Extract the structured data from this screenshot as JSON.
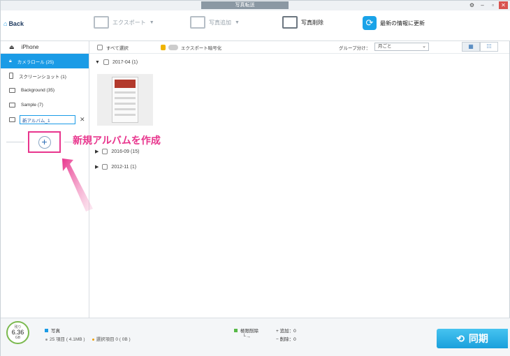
{
  "window": {
    "title": "写真転送"
  },
  "toolbar": {
    "back_label": "Back",
    "export_label": "エクスポート",
    "add_photo_label": "写真追加",
    "delete_photo_label": "写真削除",
    "refresh_label": "最新の情報に更新"
  },
  "sidebar": {
    "device": "iPhone",
    "items": [
      {
        "label": "カメラロール (25)"
      },
      {
        "label": "スクリーンショット (1)"
      },
      {
        "label": "Background (35)"
      },
      {
        "label": "Sample (7)"
      }
    ],
    "new_album_value": "新アルバム_1"
  },
  "filterbar": {
    "select_all": "すべて選択",
    "encrypt_export": "エクスポート暗号化",
    "group_label": "グループ分け：",
    "group_value": "月ごと"
  },
  "groups": [
    {
      "label": "2017-04 (1)"
    },
    {
      "label": "2016-09 (15)"
    },
    {
      "label": "2012-11 (1)"
    }
  ],
  "callout": {
    "text": "新規アルバムを作成",
    "color": "#e8358d"
  },
  "status": {
    "storage_label": "残り",
    "storage_value": "6.36",
    "storage_unit": "GB",
    "photos_label": "写真",
    "items_text": "25 項目 ( 4.1MB )",
    "selected_text": "選択項目 0 ( 0B )",
    "pending_delete": "極限削除",
    "add_count": "追加：0",
    "delete_count": "削除：0"
  },
  "sync_label": "同期",
  "colors": {
    "accent": "#1a9be6",
    "highlight": "#e8358d"
  }
}
